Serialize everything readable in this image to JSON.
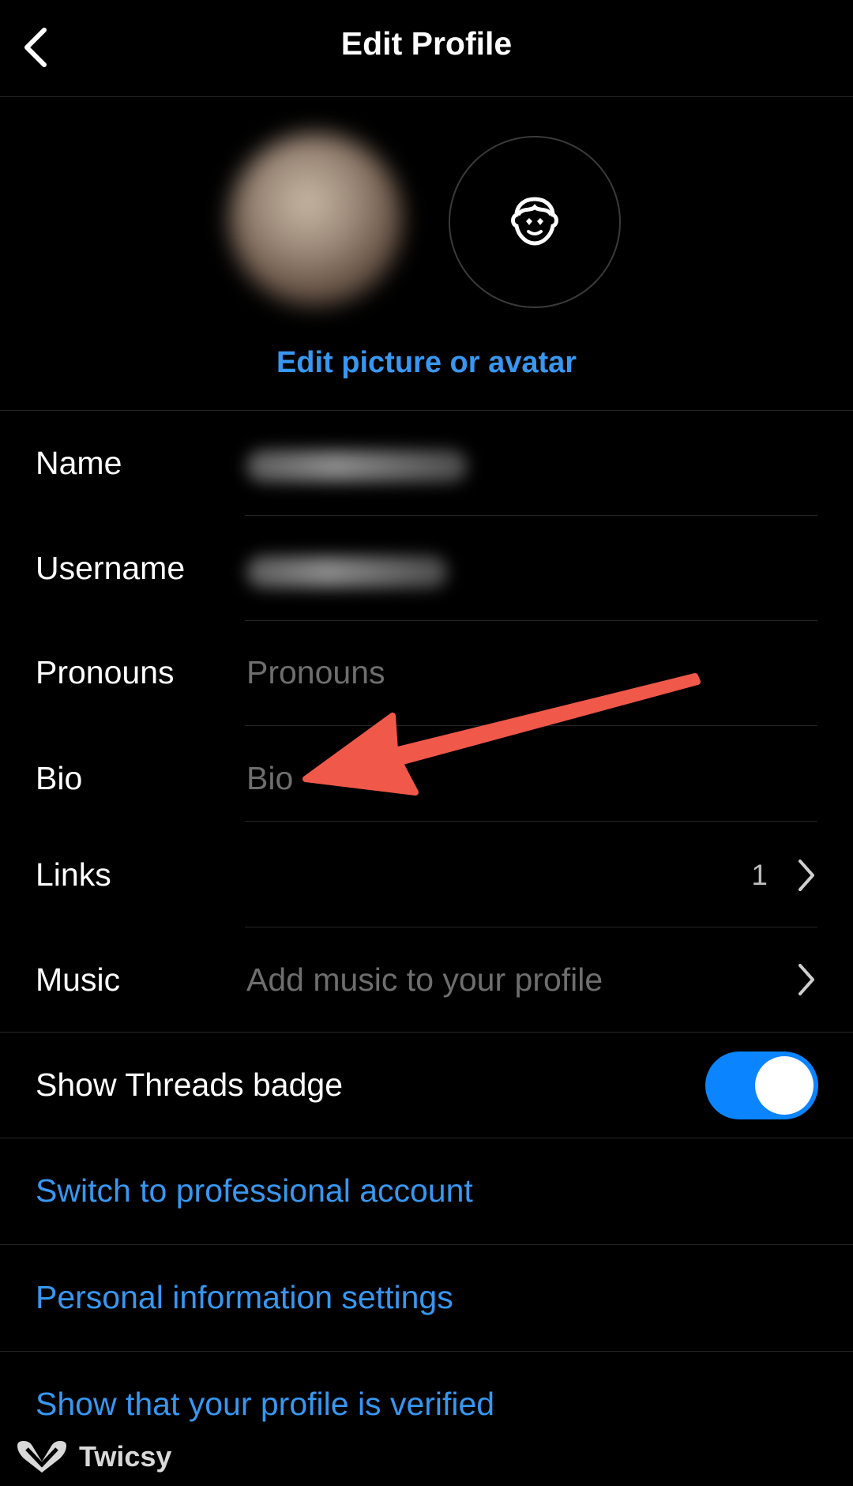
{
  "header": {
    "title": "Edit Profile",
    "back_icon": "chevron-left-icon"
  },
  "avatar_section": {
    "avatar_icon": "avatar-face-icon",
    "edit_link": "Edit picture or avatar"
  },
  "fields": {
    "name": {
      "label": "Name",
      "value": ""
    },
    "username": {
      "label": "Username",
      "value": ""
    },
    "pronouns": {
      "label": "Pronouns",
      "placeholder": "Pronouns"
    },
    "bio": {
      "label": "Bio",
      "placeholder": "Bio"
    },
    "links": {
      "label": "Links",
      "count": "1"
    },
    "music": {
      "label": "Music",
      "placeholder": "Add music to your profile"
    }
  },
  "threads_badge": {
    "label": "Show Threads badge",
    "enabled": true
  },
  "links": {
    "professional": "Switch to professional account",
    "personal_info": "Personal information settings",
    "verified": "Show that your profile is verified"
  },
  "watermark": {
    "text": "Twicsy"
  },
  "colors": {
    "background": "#000000",
    "link_blue": "#3897f0",
    "toggle_blue": "#0a84ff",
    "annotation_arrow": "#f0584a"
  }
}
